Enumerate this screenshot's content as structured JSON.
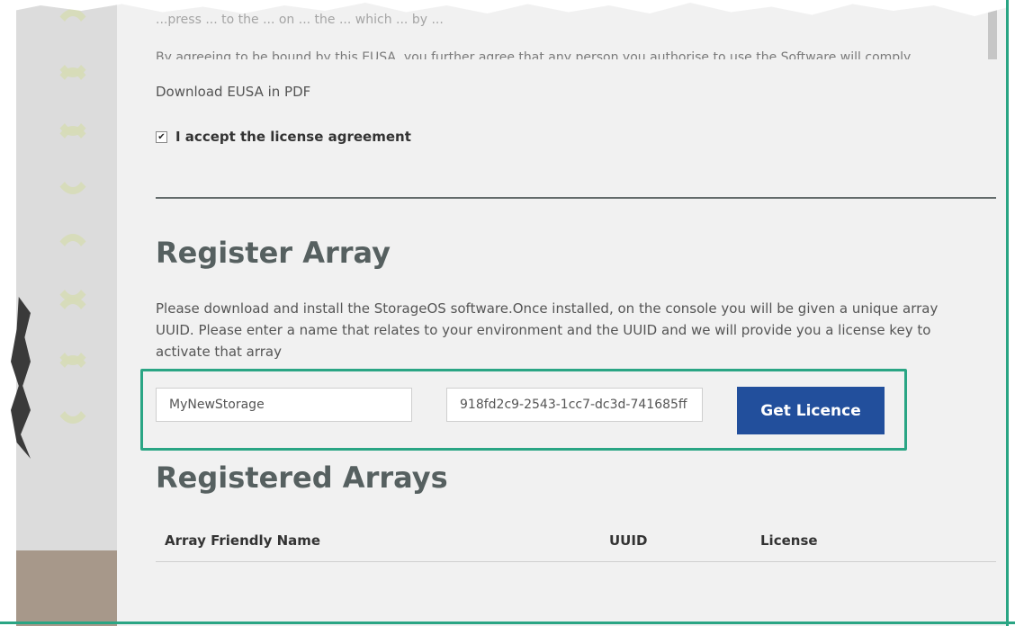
{
  "eusa": {
    "partial_line_1": "...press ... to the ... on ... the ... which ... by ...",
    "partial_line_2": "By agreeing to be bound by this EUSA, you further agree that any person you authorise to use the Software will comply",
    "download_link": "Download EUSA in PDF",
    "accept_label": "I accept the license agreement",
    "accept_checked": true
  },
  "register": {
    "title": "Register Array",
    "description": "Please download and install the StorageOS software.Once installed, on the console you will be given a unique array UUID. Please enter a name that relates to your environment and the UUID and we will provide you a license key to activate that array",
    "name_value": "MyNewStorage",
    "uuid_value": "918fd2c9-2543-1cc7-dc3d-741685ff",
    "button_label": "Get Licence"
  },
  "registered": {
    "title": "Registered Arrays",
    "columns": [
      "Array Friendly Name",
      "UUID",
      "License"
    ]
  },
  "colors": {
    "accent_border": "#2aa584",
    "button_bg": "#224f9c",
    "heading": "#566060"
  }
}
